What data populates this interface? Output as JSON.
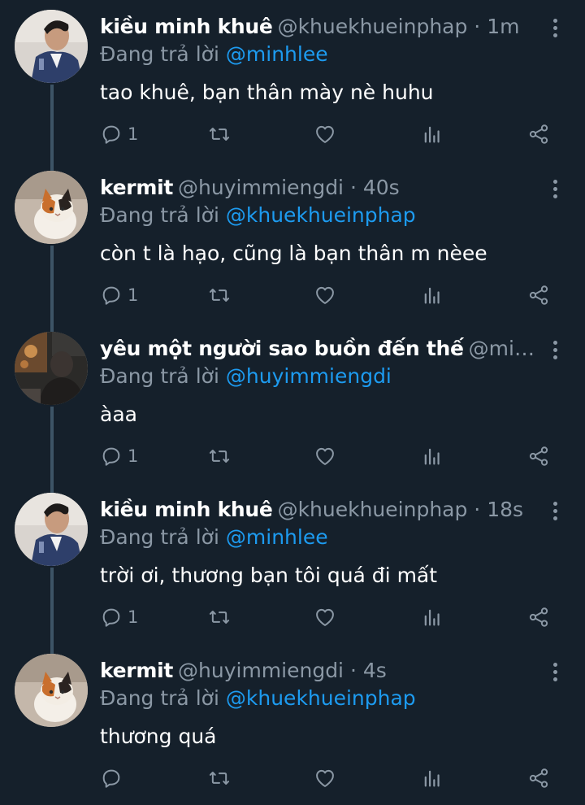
{
  "reply_prefix": "Đang trả lời",
  "sep": " · ",
  "tweets": [
    {
      "name": "kiều minh khuê",
      "handle": "@khuekhueinphap",
      "time": "1m",
      "reply_to": "@minhlee",
      "text": "tao khuê, bạn thân mày nè huhu",
      "reply_count": "1",
      "avatar": "man-in-suit"
    },
    {
      "name": "kermit",
      "handle": "@huyimmiengdi",
      "time": "40s",
      "reply_to": "@khuekhueinphap",
      "text": "còn t là hạo, cũng là bạn thân m nèee",
      "reply_count": "1",
      "avatar": "calico-cat"
    },
    {
      "name": "yêu một người sao buồn đến thế",
      "handle": "@minhlee",
      "time": "",
      "reply_to": "@huyimmiengdi",
      "text": "àaa",
      "reply_count": "1",
      "avatar": "night-street"
    },
    {
      "name": "kiều minh khuê",
      "handle": "@khuekhueinphap",
      "time": "18s",
      "reply_to": "@minhlee",
      "text": "trời ơi, thương bạn tôi quá đi mất",
      "reply_count": "1",
      "avatar": "man-in-suit"
    },
    {
      "name": "kermit",
      "handle": "@huyimmiengdi",
      "time": "4s",
      "reply_to": "@khuekhueinphap",
      "text": "thương quá",
      "reply_count": "",
      "avatar": "calico-cat"
    }
  ],
  "colors": {
    "background": "#15202b",
    "text_primary": "#ffffff",
    "text_secondary": "#8b98a5",
    "mention": "#1d9bf0",
    "thread_line": "#3d5466"
  },
  "icons": [
    "reply-icon",
    "retweet-icon",
    "like-icon",
    "analytics-icon",
    "share-icon",
    "more-icon"
  ]
}
